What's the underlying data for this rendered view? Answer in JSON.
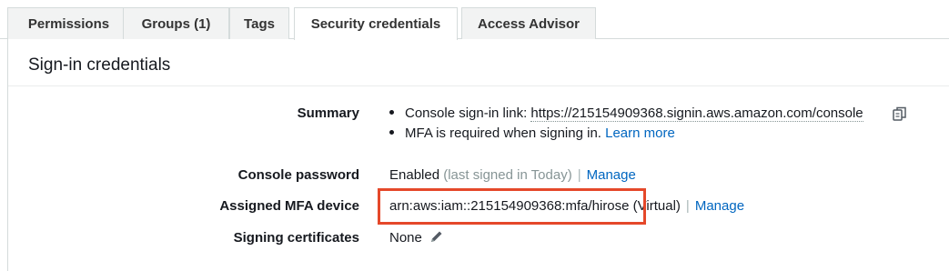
{
  "tabs": [
    {
      "label": "Permissions",
      "active": false
    },
    {
      "label": "Groups (1)",
      "active": false
    },
    {
      "label": "Tags",
      "active": false
    },
    {
      "label": "Security credentials",
      "active": true
    },
    {
      "label": "Access Advisor",
      "active": false
    }
  ],
  "section": {
    "title": "Sign-in credentials"
  },
  "summary": {
    "label": "Summary",
    "console_link_prefix": "Console sign-in link: ",
    "console_link_url": "https://215154909368.signin.aws.amazon.com/console",
    "mfa_text": "MFA is required when signing in. ",
    "learn_more": "Learn more"
  },
  "console_password": {
    "label": "Console password",
    "status": "Enabled",
    "last_signed": "(last signed in Today)",
    "separator": "|",
    "manage": "Manage"
  },
  "mfa_device": {
    "label": "Assigned MFA device",
    "arn": "arn:aws:iam::215154909368:mfa/hirose",
    "type": "(Virtual)",
    "separator": "|",
    "manage": "Manage"
  },
  "signing_certificates": {
    "label": "Signing certificates",
    "value": "None"
  },
  "colors": {
    "link": "#0066c0",
    "highlight": "#e5482a",
    "tab_bg": "#f2f3f3",
    "border": "#d5dbdb"
  }
}
